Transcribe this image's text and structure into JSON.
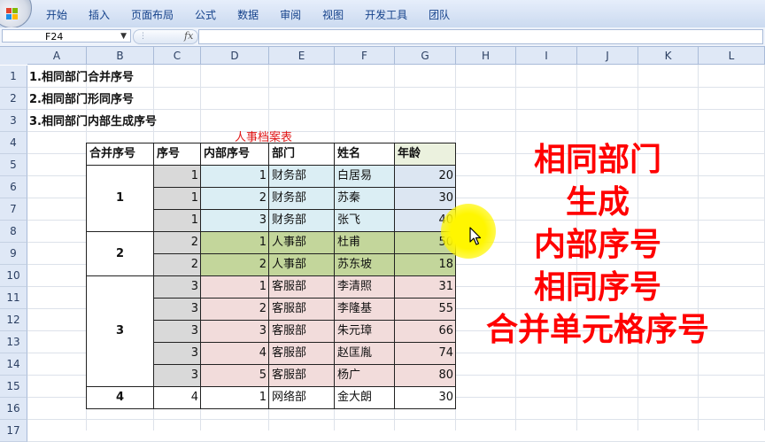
{
  "ribbon": {
    "tabs": [
      "开始",
      "插入",
      "页面布局",
      "公式",
      "数据",
      "审阅",
      "视图",
      "开发工具",
      "团队"
    ],
    "logo_colors": [
      "#e2452f",
      "#7fba00",
      "#1e90e8",
      "#ffb900"
    ]
  },
  "formula_bar": {
    "name_box": "F24",
    "fx_label": "fx",
    "formula": ""
  },
  "columns": [
    "A",
    "B",
    "C",
    "D",
    "E",
    "F",
    "G",
    "H",
    "I",
    "J",
    "K",
    "L"
  ],
  "rows": [
    "1",
    "2",
    "3",
    "4",
    "5",
    "6",
    "7",
    "8",
    "9",
    "10",
    "11",
    "12",
    "13",
    "14",
    "15",
    "16",
    "17"
  ],
  "notes": [
    "1.相同部门合并序号",
    "2.相同部门形同序号",
    "3.相同部门内部生成序号"
  ],
  "table": {
    "title": "人事档案表",
    "headers": [
      "合并序号",
      "序号",
      "内部序号",
      "部门",
      "姓名",
      "年龄"
    ],
    "merged": [
      "1",
      "2",
      "3",
      "4"
    ],
    "rows": [
      {
        "seq": "1",
        "inner": "1",
        "dept": "财务部",
        "name": "白居易",
        "age": "20"
      },
      {
        "seq": "1",
        "inner": "2",
        "dept": "财务部",
        "name": "苏秦",
        "age": "30"
      },
      {
        "seq": "1",
        "inner": "3",
        "dept": "财务部",
        "name": "张飞",
        "age": "40"
      },
      {
        "seq": "2",
        "inner": "1",
        "dept": "人事部",
        "name": "杜甫",
        "age": "50"
      },
      {
        "seq": "2",
        "inner": "2",
        "dept": "人事部",
        "name": "苏东坡",
        "age": "18"
      },
      {
        "seq": "3",
        "inner": "1",
        "dept": "客服部",
        "name": "李清照",
        "age": "31"
      },
      {
        "seq": "3",
        "inner": "2",
        "dept": "客服部",
        "name": "李隆基",
        "age": "55"
      },
      {
        "seq": "3",
        "inner": "3",
        "dept": "客服部",
        "name": "朱元璋",
        "age": "66"
      },
      {
        "seq": "3",
        "inner": "4",
        "dept": "客服部",
        "name": "赵匡胤",
        "age": "74"
      },
      {
        "seq": "3",
        "inner": "5",
        "dept": "客服部",
        "name": "杨广",
        "age": "80"
      },
      {
        "seq": "4",
        "inner": "1",
        "dept": "网络部",
        "name": "金大朗",
        "age": "30"
      }
    ]
  },
  "big_text": [
    "相同部门",
    "生成",
    "内部序号",
    "相同序号",
    "合并单元格序号"
  ],
  "colors": {
    "finance": "#dbeef4",
    "hr": "#c3d69b",
    "service": "#f2dcdb",
    "seq_gray": "#d9d9d9",
    "age_blue": "#dce6f2",
    "header_green": "#ebf1de",
    "big_text": "#ff0000",
    "title": "#e01818"
  }
}
